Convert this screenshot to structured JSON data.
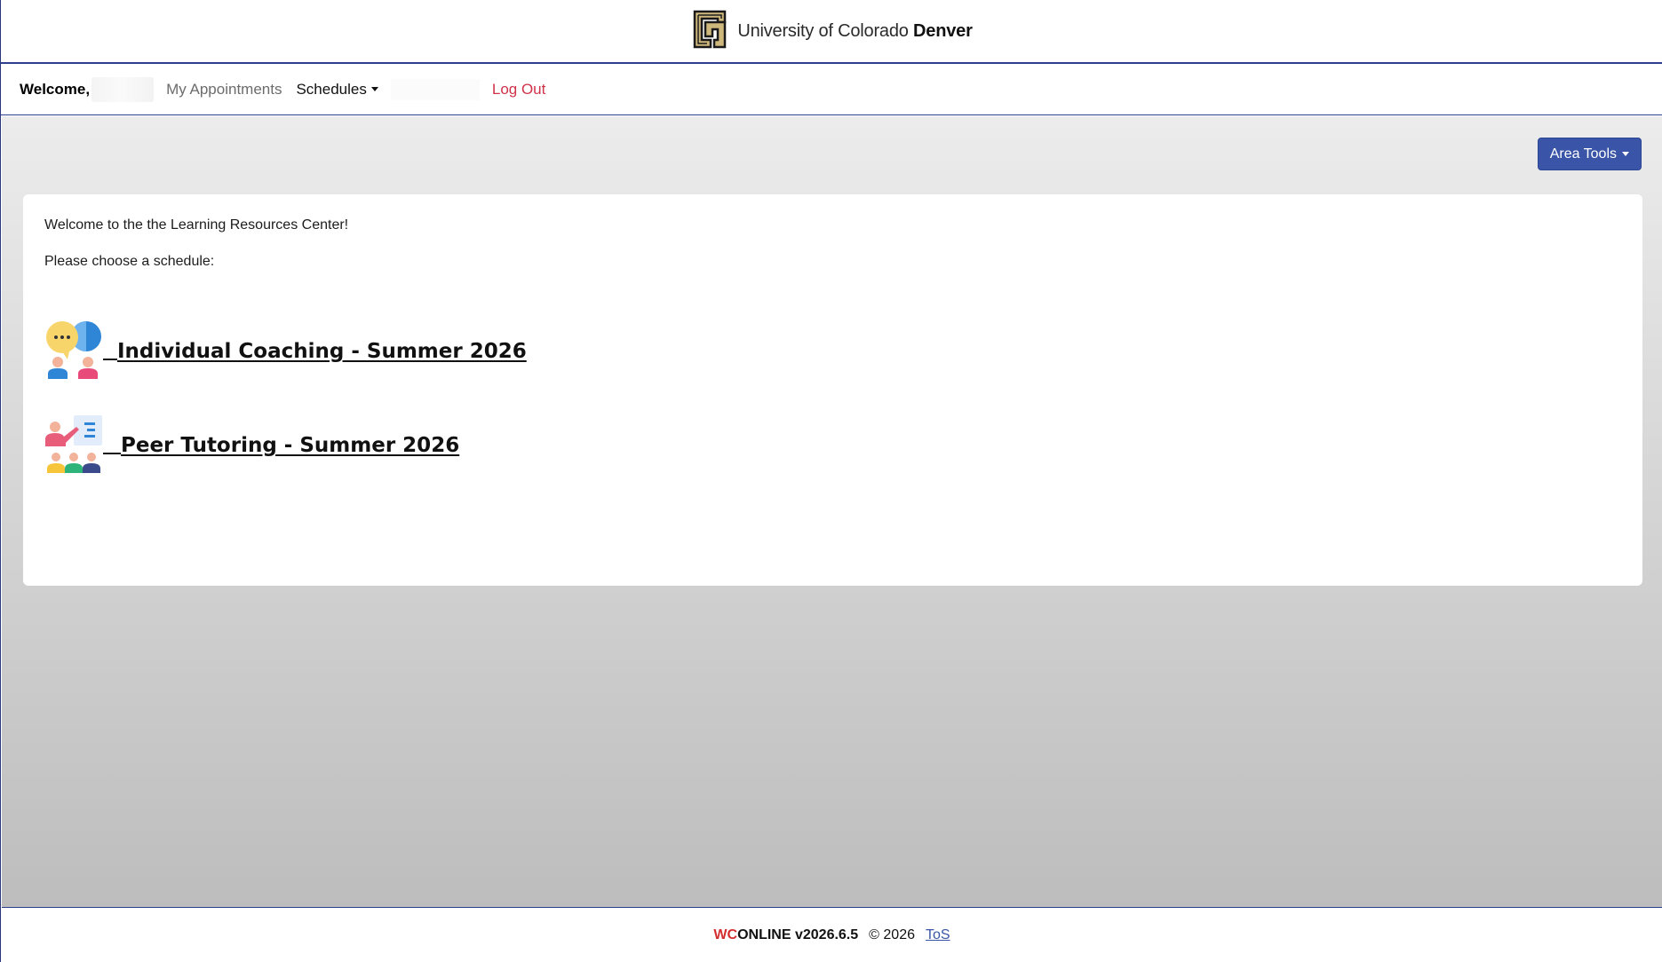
{
  "header": {
    "brand_prefix": "University of Colorado ",
    "brand_strong": "Denver"
  },
  "nav": {
    "welcome": "Welcome,",
    "my_appointments": "My Appointments",
    "schedules": "Schedules",
    "logout": "Log Out"
  },
  "toolbar": {
    "area_tools": "Area Tools"
  },
  "content": {
    "welcome_message": "Welcome to the the Learning Resources Center!",
    "choose_message": "Please choose a schedule:",
    "schedules": [
      {
        "label": "Individual Coaching - Summer 2026",
        "icon": "coaching-icon"
      },
      {
        "label": "Peer Tutoring - Summer 2026",
        "icon": "tutoring-icon"
      }
    ]
  },
  "footer": {
    "wc": "WC",
    "online": "ONLINE v2026.6.5",
    "copyright": "© 2026",
    "tos": "ToS"
  },
  "colors": {
    "accent": "#3a55a8",
    "logout": "#d0324a",
    "border": "#2e3f8f"
  }
}
